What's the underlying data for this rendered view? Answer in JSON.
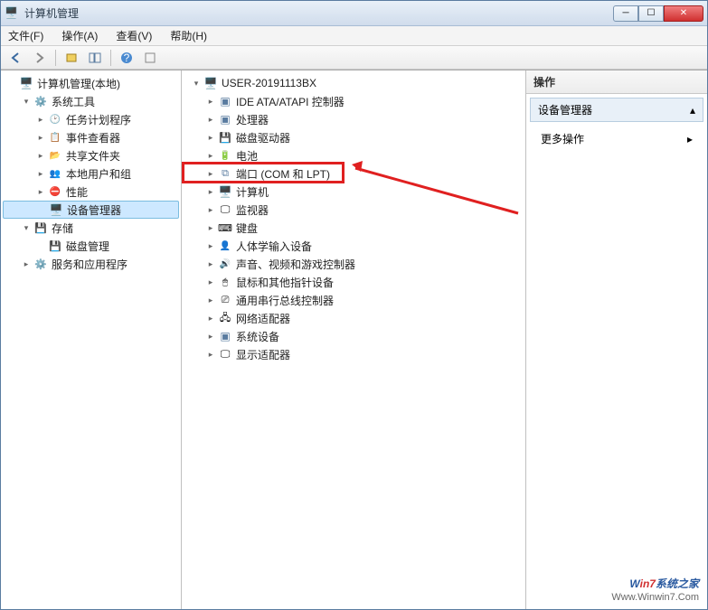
{
  "window": {
    "title": "计算机管理"
  },
  "menu": {
    "file": "文件(F)",
    "action": "操作(A)",
    "view": "查看(V)",
    "help": "帮助(H)"
  },
  "toolbar_icons": [
    "back",
    "forward",
    "up",
    "show-hide",
    "properties",
    "help",
    "mmc"
  ],
  "left_tree": [
    {
      "indent": 0,
      "expander": "",
      "icon": "ico-monitor",
      "label": "计算机管理(本地)"
    },
    {
      "indent": 1,
      "expander": "▾",
      "icon": "ico-gear",
      "label": "系统工具"
    },
    {
      "indent": 2,
      "expander": "▸",
      "icon": "ico-clock",
      "label": "任务计划程序"
    },
    {
      "indent": 2,
      "expander": "▸",
      "icon": "ico-event",
      "label": "事件查看器"
    },
    {
      "indent": 2,
      "expander": "▸",
      "icon": "ico-share",
      "label": "共享文件夹"
    },
    {
      "indent": 2,
      "expander": "▸",
      "icon": "ico-users",
      "label": "本地用户和组"
    },
    {
      "indent": 2,
      "expander": "▸",
      "icon": "ico-perf",
      "label": "性能"
    },
    {
      "indent": 2,
      "expander": "",
      "icon": "ico-monitor",
      "label": "设备管理器",
      "selected": true
    },
    {
      "indent": 1,
      "expander": "▾",
      "icon": "ico-disk",
      "label": "存储"
    },
    {
      "indent": 2,
      "expander": "",
      "icon": "ico-disk",
      "label": "磁盘管理"
    },
    {
      "indent": 1,
      "expander": "▸",
      "icon": "ico-gear",
      "label": "服务和应用程序"
    }
  ],
  "mid_tree": [
    {
      "indent": 0,
      "expander": "▾",
      "icon": "ico-monitor",
      "label": "USER-20191113BX"
    },
    {
      "indent": 1,
      "expander": "▸",
      "icon": "ico-chip",
      "label": "IDE ATA/ATAPI 控制器"
    },
    {
      "indent": 1,
      "expander": "▸",
      "icon": "ico-chip",
      "label": "处理器"
    },
    {
      "indent": 1,
      "expander": "▸",
      "icon": "ico-disk",
      "label": "磁盘驱动器"
    },
    {
      "indent": 1,
      "expander": "▸",
      "icon": "ico-battery",
      "label": "电池"
    },
    {
      "indent": 1,
      "expander": "▸",
      "icon": "ico-port",
      "label": "端口 (COM 和 LPT)",
      "highlight": true
    },
    {
      "indent": 1,
      "expander": "▸",
      "icon": "ico-monitor",
      "label": "计算机"
    },
    {
      "indent": 1,
      "expander": "▸",
      "icon": "ico-display",
      "label": "监视器"
    },
    {
      "indent": 1,
      "expander": "▸",
      "icon": "ico-keyboard",
      "label": "键盘"
    },
    {
      "indent": 1,
      "expander": "▸",
      "icon": "ico-human",
      "label": "人体学输入设备"
    },
    {
      "indent": 1,
      "expander": "▸",
      "icon": "ico-sound",
      "label": "声音、视频和游戏控制器"
    },
    {
      "indent": 1,
      "expander": "▸",
      "icon": "ico-mouse",
      "label": "鼠标和其他指针设备"
    },
    {
      "indent": 1,
      "expander": "▸",
      "icon": "ico-usb",
      "label": "通用串行总线控制器"
    },
    {
      "indent": 1,
      "expander": "▸",
      "icon": "ico-net",
      "label": "网络适配器"
    },
    {
      "indent": 1,
      "expander": "▸",
      "icon": "ico-chip",
      "label": "系统设备"
    },
    {
      "indent": 1,
      "expander": "▸",
      "icon": "ico-display",
      "label": "显示适配器"
    }
  ],
  "actions": {
    "header": "操作",
    "subheader": "设备管理器",
    "more": "更多操作"
  },
  "watermark": {
    "brand_prefix": "W",
    "brand_accent": "in7",
    "brand_suffix": "系统之家",
    "url": "Www.Winwin7.Com"
  }
}
